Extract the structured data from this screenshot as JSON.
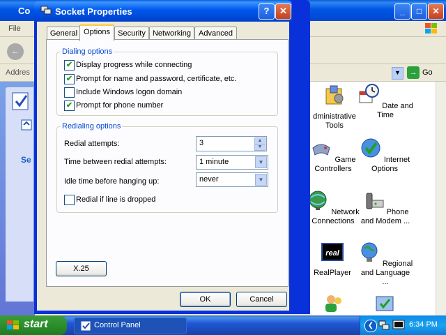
{
  "background_window": {
    "title": "Co",
    "menu": {
      "file": "File"
    },
    "address_label": "Addres",
    "go_label": "Go",
    "left_panel_heading": "Se",
    "items": [
      {
        "label": "dministrative Tools",
        "icon": "administrative-tools-icon"
      },
      {
        "label": "Date and Time",
        "icon": "date-time-icon"
      },
      {
        "label": "Game Controllers",
        "icon": "game-controllers-icon"
      },
      {
        "label": "Internet Options",
        "icon": "internet-options-icon"
      },
      {
        "label": "Network Connections",
        "icon": "network-connections-icon"
      },
      {
        "label": "Phone and Modem ...",
        "icon": "phone-modem-icon"
      },
      {
        "label": "RealPlayer",
        "icon": "realplayer-icon"
      },
      {
        "label": "Regional and Language ...",
        "icon": "regional-language-icon"
      }
    ]
  },
  "dialog": {
    "title": "Socket Properties",
    "tabs": [
      "General",
      "Options",
      "Security",
      "Networking",
      "Advanced"
    ],
    "active_tab": "Options",
    "dialing": {
      "legend": "Dialing options",
      "options": [
        {
          "label": "Display progress while connecting",
          "checked": true
        },
        {
          "label": "Prompt for name and password, certificate, etc.",
          "checked": true
        },
        {
          "label": "Include Windows logon domain",
          "checked": false
        },
        {
          "label": "Prompt for phone number",
          "checked": true
        }
      ]
    },
    "redialing": {
      "legend": "Redialing options",
      "attempts_label": "Redial attempts:",
      "attempts_value": "3",
      "between_label": "Time between redial attempts:",
      "between_value": "1 minute",
      "idle_label": "Idle time before hanging up:",
      "idle_value": "never",
      "redial_if_dropped_label": "Redial if line is dropped",
      "redial_if_dropped_checked": false
    },
    "x25_button": "X.25",
    "ok_button": "OK",
    "cancel_button": "Cancel"
  },
  "taskbar": {
    "start_label": "start",
    "task_label": "Control Panel",
    "clock": "6:34 PM"
  },
  "colors": {
    "xp_blue": "#0058ee",
    "group_legend": "#0046d5",
    "tab_highlight": "#ffc73c",
    "start_green": "#2b8f2b"
  }
}
